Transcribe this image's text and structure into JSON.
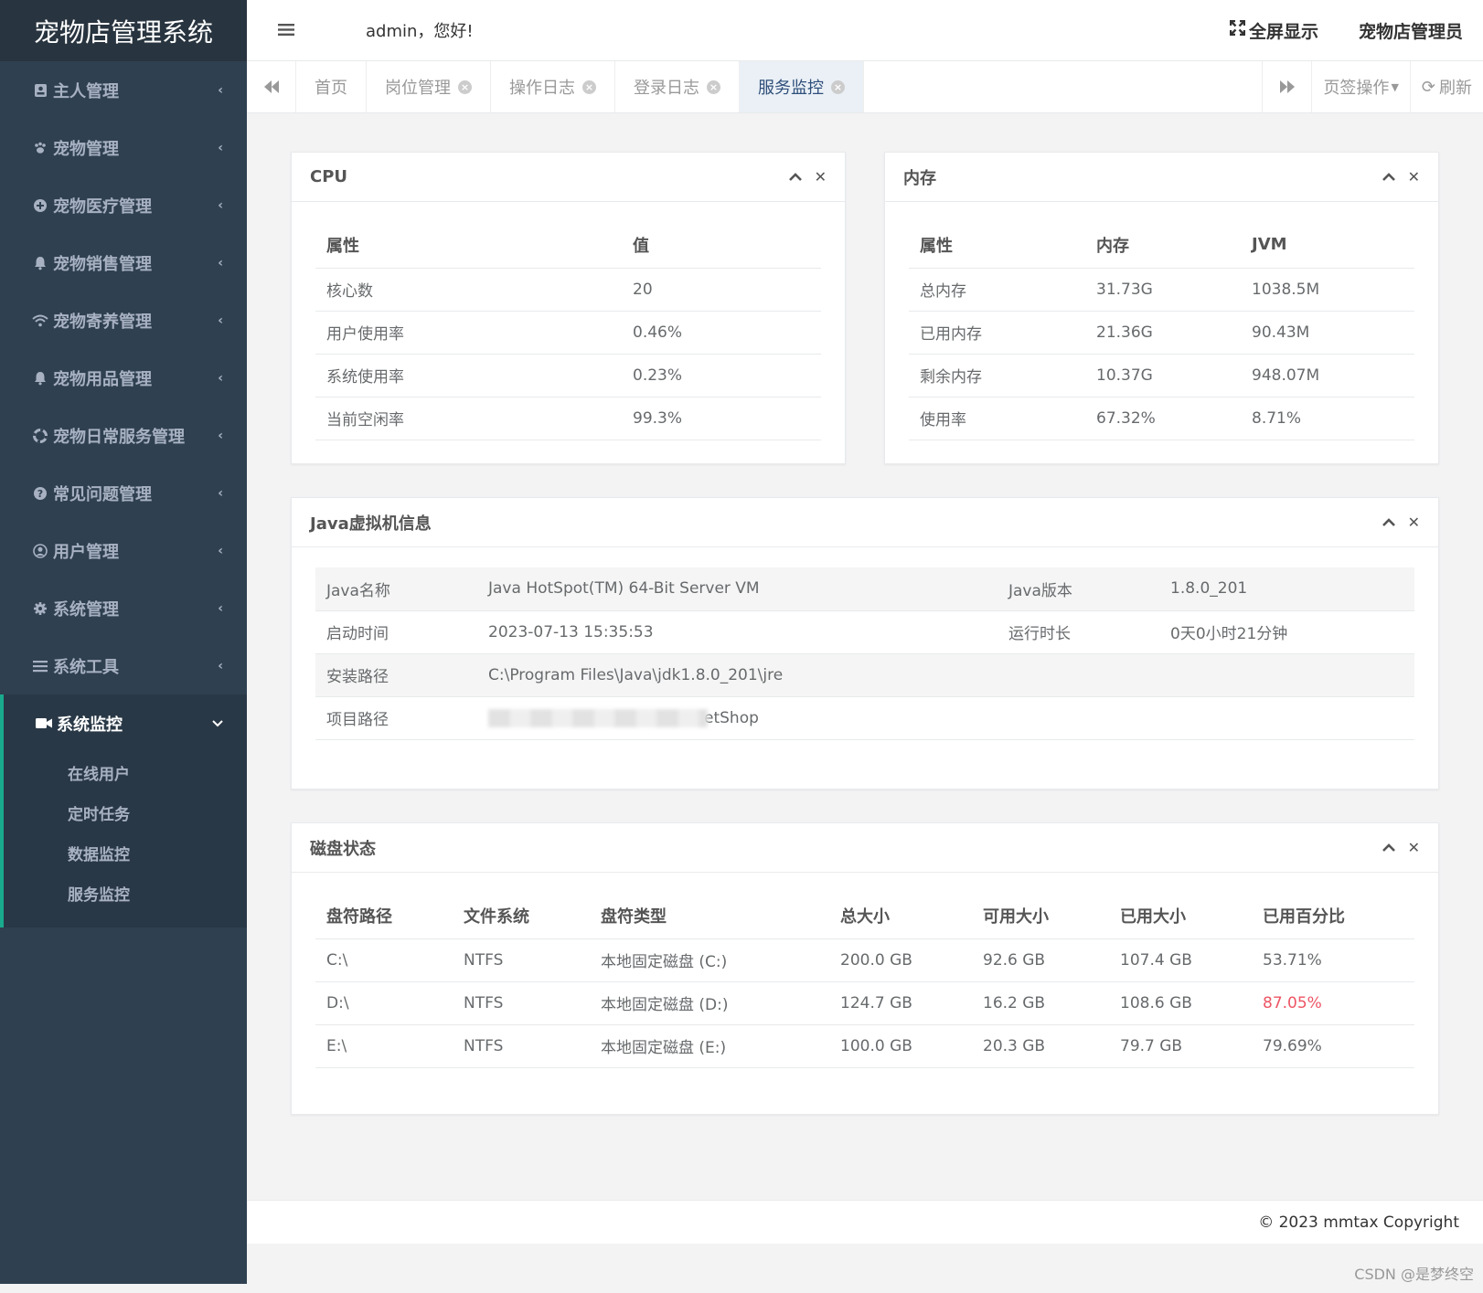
{
  "app": {
    "title": "宠物店管理系统"
  },
  "header": {
    "greeting": "admin，您好!",
    "fullscreen_label": "全屏显示",
    "user_label": "宠物店管理员"
  },
  "sidebar": {
    "items": [
      {
        "label": "主人管理",
        "icon": "id-card-icon"
      },
      {
        "label": "宠物管理",
        "icon": "paw-icon"
      },
      {
        "label": "宠物医疗管理",
        "icon": "plus-circle-icon"
      },
      {
        "label": "宠物销售管理",
        "icon": "bell-icon"
      },
      {
        "label": "宠物寄养管理",
        "icon": "wifi-icon"
      },
      {
        "label": "宠物用品管理",
        "icon": "bell-icon"
      },
      {
        "label": "宠物日常服务管理",
        "icon": "life-ring-icon"
      },
      {
        "label": "常见问题管理",
        "icon": "question-circle-icon"
      },
      {
        "label": "用户管理",
        "icon": "user-circle-icon"
      },
      {
        "label": "系统管理",
        "icon": "gear-icon"
      },
      {
        "label": "系统工具",
        "icon": "bars-icon"
      }
    ],
    "active": {
      "label": "系统监控",
      "icon": "video-camera-icon",
      "children": [
        "在线用户",
        "定时任务",
        "数据监控",
        "服务监控"
      ]
    }
  },
  "tabs": {
    "items": [
      "首页",
      "岗位管理",
      "操作日志",
      "登录日志",
      "服务监控"
    ],
    "active": "服务监控",
    "page_ops": "页签操作",
    "refresh": "刷新"
  },
  "cpu": {
    "title": "CPU",
    "headers": [
      "属性",
      "值"
    ],
    "rows": [
      [
        "核心数",
        "20"
      ],
      [
        "用户使用率",
        "0.46%"
      ],
      [
        "系统使用率",
        "0.23%"
      ],
      [
        "当前空闲率",
        "99.3%"
      ]
    ]
  },
  "memory": {
    "title": "内存",
    "headers": [
      "属性",
      "内存",
      "JVM"
    ],
    "rows": [
      [
        "总内存",
        "31.73G",
        "1038.5M"
      ],
      [
        "已用内存",
        "21.36G",
        "90.43M"
      ],
      [
        "剩余内存",
        "10.37G",
        "948.07M"
      ],
      [
        "使用率",
        "67.32%",
        "8.71%"
      ]
    ]
  },
  "jvm": {
    "title": "Java虚拟机信息",
    "name_label": "Java名称",
    "name_value": "Java HotSpot(TM) 64-Bit Server VM",
    "version_label": "Java版本",
    "version_value": "1.8.0_201",
    "start_label": "启动时间",
    "start_value": "2023-07-13 15:35:53",
    "uptime_label": "运行时长",
    "uptime_value": "0天0小时21分钟",
    "install_label": "安装路径",
    "install_value": "C:\\Program Files\\Java\\jdk1.8.0_201\\jre",
    "project_label": "项目路径",
    "project_value_visible": "etShop"
  },
  "disk": {
    "title": "磁盘状态",
    "headers": [
      "盘符路径",
      "文件系统",
      "盘符类型",
      "总大小",
      "可用大小",
      "已用大小",
      "已用百分比"
    ],
    "rows": [
      [
        "C:\\",
        "NTFS",
        "本地固定磁盘 (C:)",
        "200.0 GB",
        "92.6 GB",
        "107.4 GB",
        "53.71%"
      ],
      [
        "D:\\",
        "NTFS",
        "本地固定磁盘 (D:)",
        "124.7 GB",
        "16.2 GB",
        "108.6 GB",
        "87.05%"
      ],
      [
        "E:\\",
        "NTFS",
        "本地固定磁盘 (E:)",
        "100.0 GB",
        "20.3 GB",
        "79.7 GB",
        "79.69%"
      ]
    ],
    "warn_color": "#ed5565"
  },
  "footer": {
    "copyright": "© 2023 mmtax Copyright"
  },
  "watermark": "CSDN @是梦终空"
}
